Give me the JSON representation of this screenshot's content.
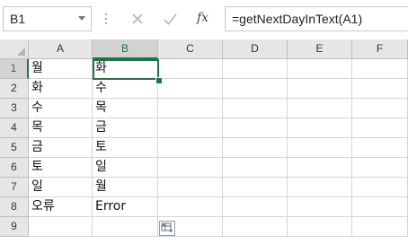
{
  "formula_bar": {
    "name_box": "B1",
    "fx_label": "fx",
    "formula": "=getNextDayInText(A1)"
  },
  "columns": [
    "A",
    "B",
    "C",
    "D",
    "E",
    "F"
  ],
  "rows": [
    {
      "num": "1",
      "A": "월",
      "B": "화"
    },
    {
      "num": "2",
      "A": "화",
      "B": "수"
    },
    {
      "num": "3",
      "A": "수",
      "B": "목"
    },
    {
      "num": "4",
      "A": "목",
      "B": "금"
    },
    {
      "num": "5",
      "A": "금",
      "B": "토"
    },
    {
      "num": "6",
      "A": "토",
      "B": "일"
    },
    {
      "num": "7",
      "A": "일",
      "B": "월"
    },
    {
      "num": "8",
      "A": "오류",
      "B": "Error"
    },
    {
      "num": "9",
      "A": "",
      "B": ""
    }
  ],
  "selected_cell": "B1",
  "colors": {
    "accent": "#217346",
    "header_bg": "#e6e6e6",
    "gridline": "#d4d4d4"
  }
}
